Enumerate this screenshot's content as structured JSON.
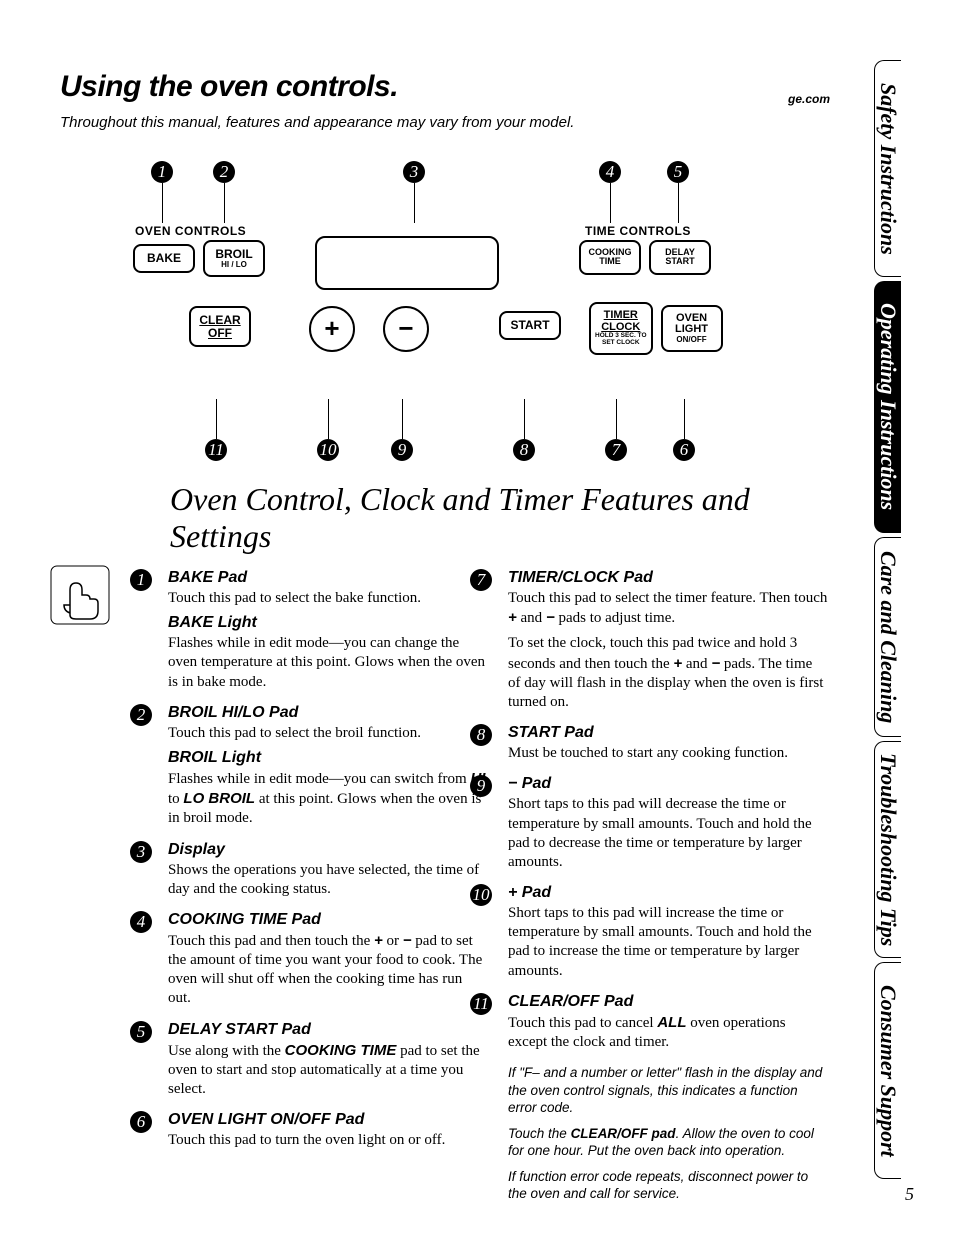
{
  "header": {
    "title": "Using the oven controls.",
    "site": "ge.com",
    "intro": "Throughout this manual, features and appearance may vary from your model."
  },
  "tabs": [
    "Safety Instructions",
    "Operating Instructions",
    "Care and Cleaning",
    "Troubleshooting Tips",
    "Consumer Support"
  ],
  "panel": {
    "group_oven": "OVEN CONTROLS",
    "group_time": "TIME CONTROLS",
    "bake": "BAKE",
    "broil": "BROIL",
    "broil_sub": "HI / LO",
    "cooking_time": "COOKING\nTIME",
    "delay_start": "DELAY\nSTART",
    "clear_off": "CLEAR\nOFF",
    "plus": "+",
    "minus": "−",
    "start": "START",
    "timer_clock": "TIMER\nCLOCK",
    "timer_clock_sub": "HOLD 3 SEC. TO\nSET CLOCK",
    "oven_light": "OVEN\nLIGHT",
    "oven_light_sub": "ON/OFF",
    "callouts_top": [
      "1",
      "2",
      "3",
      "4",
      "5"
    ],
    "callouts_bot": [
      "11",
      "10",
      "9",
      "8",
      "7",
      "6"
    ]
  },
  "section_heading": "Oven Control, Clock and Timer Features and Settings",
  "left": [
    {
      "n": "1",
      "h": "BAKE Pad",
      "b": "Touch this pad to select the bake function.",
      "h2": "BAKE Light",
      "b2": "Flashes while in edit mode—you can change the oven temperature at this point. Glows when the oven is in bake mode."
    },
    {
      "n": "2",
      "h": "BROIL HI/LO Pad",
      "b": "Touch this pad to select the broil function.",
      "h2": "BROIL Light",
      "b2_html": "Flashes while in edit mode—you can switch from <span class='b'>HI</span> to <span class='b'>LO BROIL</span> at this point. Glows when the oven is in broil mode."
    },
    {
      "n": "3",
      "h": "Display",
      "b": "Shows the operations you have selected, the time of day and the cooking status."
    },
    {
      "n": "4",
      "h": "COOKING TIME Pad",
      "b_html": "Touch this pad and then touch the <span class='b'>+</span> or <span class='b'>−</span> pad to set the amount of time you want your food to cook. The oven will shut off when the cooking time has run out."
    },
    {
      "n": "5",
      "h": "DELAY START Pad",
      "b_html": "Use along with the <span class='b'>COOKING TIME</span> pad to set the oven to start and stop automatically at a time you select."
    },
    {
      "n": "6",
      "h": "OVEN LIGHT ON/OFF Pad",
      "b": "Touch this pad to turn the oven light on or off."
    }
  ],
  "right": [
    {
      "n": "7",
      "h": "TIMER/CLOCK Pad",
      "b_html": "Touch this pad to select the timer feature. Then touch <span class='b'>+</span> and <span class='b'>−</span> pads to adjust time.",
      "b2_html": "To set the clock, touch this pad twice and hold 3 seconds and then touch the <span class='b'>+</span> and <span class='b'>−</span> pads. The time of day will flash in the display when the oven is first turned on."
    },
    {
      "n": "8",
      "h": "START Pad",
      "b": "Must be touched to start any cooking function."
    },
    {
      "n": "9",
      "h": "− Pad",
      "b": "Short taps to this pad will decrease the time or temperature by small amounts. Touch and hold the pad to decrease the time or temperature by larger amounts."
    },
    {
      "n": "10",
      "h": "+ Pad",
      "b": "Short taps to this pad will increase the time or temperature by small amounts. Touch and hold the pad to increase the time or temperature by larger amounts."
    },
    {
      "n": "11",
      "h": "CLEAR/OFF Pad",
      "b_html": "Touch this pad to cancel <span class='b'>ALL</span> oven operations except the clock and timer."
    }
  ],
  "notes": [
    "If \"F– and a number or letter\" flash in the display and the oven control signals, this indicates a function error code.",
    "Touch the <span class='b'>CLEAR/OFF pad</span>. Allow the oven to cool for one hour. Put the oven back into operation.",
    "If function error code repeats, disconnect power to the oven and call for service."
  ],
  "page_number": "5"
}
